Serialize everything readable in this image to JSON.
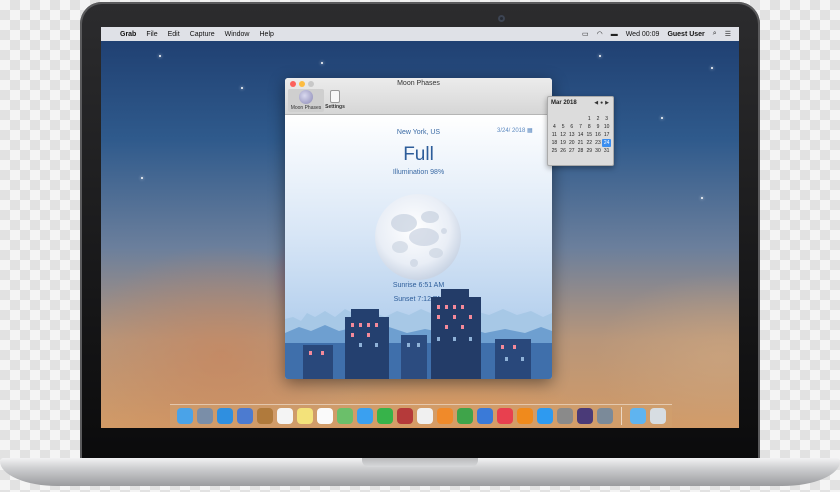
{
  "menubar": {
    "app_name": "Grab",
    "items": [
      "File",
      "Edit",
      "Capture",
      "Window",
      "Help"
    ],
    "clock": "Wed 00:09",
    "user": "Guest User"
  },
  "window": {
    "title": "Moon Phases",
    "toolbar": {
      "moon_phases_label": "Moon Phases",
      "settings_label": "Settings"
    }
  },
  "moon": {
    "location": "New York, US",
    "date": "3/24/ 2018",
    "phase": "Full",
    "illumination": "Illumination 98%",
    "sunrise": "Sunrise 6:51 AM",
    "sunset": "Sunset 7:12 PM"
  },
  "calendar": {
    "month": "Mar 2018",
    "rows": [
      [
        "",
        "",
        "",
        "",
        "1",
        "2",
        "3"
      ],
      [
        "4",
        "5",
        "6",
        "7",
        "8",
        "9",
        "10"
      ],
      [
        "11",
        "12",
        "13",
        "14",
        "15",
        "16",
        "17"
      ],
      [
        "18",
        "19",
        "20",
        "21",
        "22",
        "23",
        "24"
      ],
      [
        "25",
        "26",
        "27",
        "28",
        "29",
        "30",
        "31"
      ]
    ],
    "selected_day": "24"
  },
  "dock": {
    "apps": [
      {
        "icon": "finder-icon",
        "color": "#4aa3e8"
      },
      {
        "icon": "launchpad-icon",
        "color": "#7a8ea8"
      },
      {
        "icon": "safari-icon",
        "color": "#2f8fe0"
      },
      {
        "icon": "mail-stamp-icon",
        "color": "#4c7bd0"
      },
      {
        "icon": "contacts-icon",
        "color": "#b07a3c"
      },
      {
        "icon": "calendar-icon",
        "color": "#f4f4f4"
      },
      {
        "icon": "notes-icon",
        "color": "#f3e27a"
      },
      {
        "icon": "reminders-icon",
        "color": "#fafafa"
      },
      {
        "icon": "maps-icon",
        "color": "#6bbf6a"
      },
      {
        "icon": "messages-icon",
        "color": "#3aa0f0"
      },
      {
        "icon": "facetime-icon",
        "color": "#37b34a"
      },
      {
        "icon": "photo-booth-icon",
        "color": "#b53a3a"
      },
      {
        "icon": "photos-icon",
        "color": "#f0f0f0"
      },
      {
        "icon": "pages-icon",
        "color": "#f08a2a"
      },
      {
        "icon": "numbers-icon",
        "color": "#3fa44a"
      },
      {
        "icon": "keynote-icon",
        "color": "#3a7ad8"
      },
      {
        "icon": "music-icon",
        "color": "#e8404f"
      },
      {
        "icon": "ibooks-icon",
        "color": "#f08a1c"
      },
      {
        "icon": "app-store-icon",
        "color": "#2e9af0"
      },
      {
        "icon": "system-preferences-icon",
        "color": "#8a8a8a"
      },
      {
        "icon": "moon-phases-icon",
        "color": "#4a3a78"
      },
      {
        "icon": "preview-icon",
        "color": "#7b8a99"
      }
    ],
    "trailing": [
      {
        "icon": "downloads-folder-icon",
        "color": "#5fb4f0"
      },
      {
        "icon": "trash-icon",
        "color": "#d7dde2"
      }
    ]
  }
}
